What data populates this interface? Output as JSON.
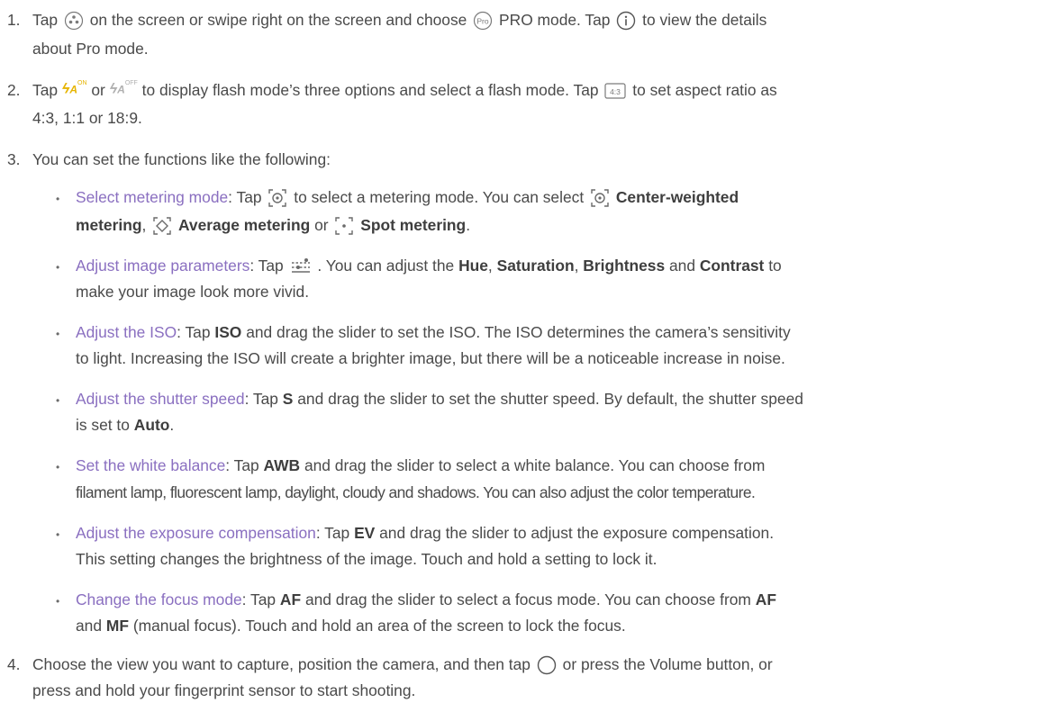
{
  "steps": [
    {
      "number": "1.",
      "line1": {
        "t1": "Tap",
        "t2": "on the screen or swipe right on the screen and choose",
        "t3": "PRO mode. Tap",
        "t4": "to view the details"
      },
      "line2": "about Pro mode."
    },
    {
      "number": "2.",
      "line1": {
        "t1": "Tap",
        "t2": "or",
        "t3": "to display flash mode’s three options and select a flash mode. Tap",
        "t4": "to set aspect ratio as"
      },
      "line2": "4:3, 1:1 or 18:9."
    },
    {
      "number": "3.",
      "line1": "You can set the functions like the following:"
    },
    {
      "number": "4.",
      "line1": {
        "t1": "Choose the view you want to capture, position the camera, and then tap",
        "t2": "or press the Volume button, or"
      },
      "line2": "press and hold your fingerprint sensor to start shooting."
    }
  ],
  "icons": {
    "pro_mode_text": "Pro",
    "aspect_ratio_text": "4:3",
    "flash_on_text": "ON",
    "flash_off_text": "OFF",
    "flash_letter": "A",
    "colors": {
      "accent": "#8a6fc0",
      "flash_on": "#e6b400",
      "icon_gray": "#7a7a7a"
    }
  },
  "functions": [
    {
      "title": "Select metering mode",
      "l1": {
        "t1": ": Tap",
        "t2": "to select a metering mode. You can select",
        "b1": "Center-weighted"
      },
      "l2": {
        "b1": "metering",
        "t1": ",",
        "b2": "Average metering",
        "t2": "or",
        "b3": "Spot metering",
        "t3": "."
      }
    },
    {
      "title": "Adjust image parameters",
      "l1": {
        "t1": ": Tap",
        "t2": ". You can adjust the",
        "b1": "Hue",
        "t3": ",",
        "b2": "Saturation",
        "t4": ",",
        "b3": "Brightness",
        "t5": "and",
        "b4": "Contrast",
        "t6": "to"
      },
      "l2": "make your image look more vivid."
    },
    {
      "title": "Adjust the ISO",
      "l1": {
        "t1": ": Tap",
        "b1": "ISO",
        "t2": "and drag the slider to set the ISO. The ISO determines the camera’s sensitivity"
      },
      "l2": "to light. Increasing the ISO will create a brighter image, but there will be a noticeable increase in noise."
    },
    {
      "title": "Adjust the shutter speed",
      "l1": {
        "t1": ": Tap",
        "b1": "S",
        "t2": "and drag the slider to set the shutter speed. By default, the shutter speed"
      },
      "l2": {
        "t1": "is set to",
        "b1": "Auto",
        "t2": "."
      }
    },
    {
      "title": "Set the white balance",
      "l1": {
        "t1": ": Tap",
        "b1": "AWB",
        "t2": "and drag the slider to select a white balance. You can choose from"
      },
      "l2": "filament lamp, fluorescent lamp, daylight, cloudy and shadows. You can also adjust the color temperature."
    },
    {
      "title": "Adjust the exposure compensation",
      "l1": {
        "t1": ": Tap",
        "b1": "EV",
        "t2": "and drag the slider to adjust the exposure compensation."
      },
      "l2": "This setting changes the brightness of the image. Touch and hold a setting to lock it."
    },
    {
      "title": "Change the focus mode",
      "l1": {
        "t1": ": Tap",
        "b1": "AF",
        "t2": "and drag the slider to select a focus mode. You can choose from",
        "b2": "AF"
      },
      "l2": {
        "b1": "and",
        "b2": "MF",
        "t1": "(manual focus). Touch and hold an area of the screen to lock the focus."
      }
    }
  ]
}
